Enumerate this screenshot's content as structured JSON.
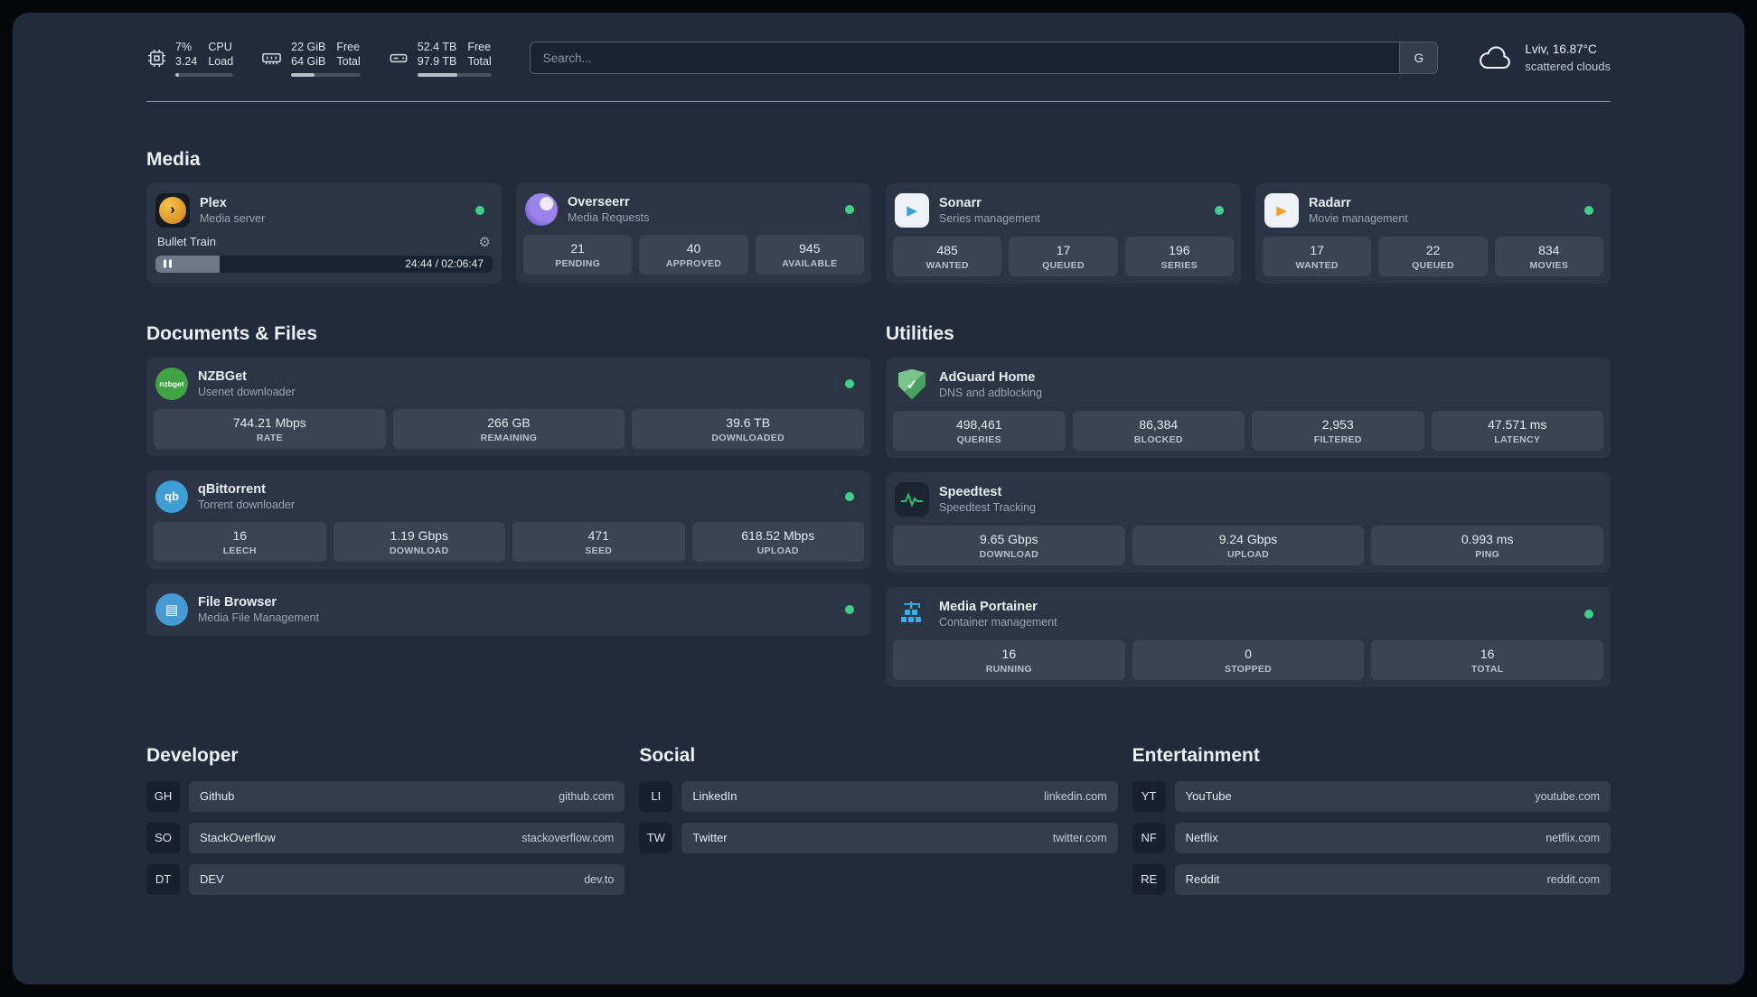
{
  "colors": {
    "background": "#212b3b",
    "card": "#2c3545",
    "stat_tile": "#3b4453",
    "status_online": "#3ecf8e",
    "plex_amber": "#e5a00d",
    "speedtest_green": "#2fbf71",
    "portainer_blue": "#2fb3e8"
  },
  "icons": {
    "plex": "›",
    "sonarr": "▶",
    "radarr": "▶",
    "nzbget": "nzbget",
    "qbittorrent": "qb",
    "filebrowser": "▤",
    "adguard_check": "✓",
    "gear": "⚙"
  },
  "topbar": {
    "resources": [
      {
        "value1": "7%",
        "value2": "3.24",
        "label1": "CPU",
        "label2": "Load",
        "progress": 7
      },
      {
        "value1": "22 GiB",
        "value2": "64 GiB",
        "label1": "Free",
        "label2": "Total",
        "progress": 34
      },
      {
        "value1": "52.4 TB",
        "value2": "97.9 TB",
        "label1": "Free",
        "label2": "Total",
        "progress": 54
      }
    ],
    "search": {
      "placeholder": "Search...",
      "button": "G"
    },
    "weather": {
      "line1": "Lviv, 16.87°C",
      "line2": "scattered clouds"
    }
  },
  "media": {
    "title": "Media",
    "plex": {
      "name": "Plex",
      "subtitle": "Media server",
      "now_playing": "Bullet Train",
      "time": "24:44 / 02:06:47",
      "progress": 19
    },
    "overseerr": {
      "name": "Overseerr",
      "subtitle": "Media Requests",
      "stats": [
        {
          "value": "21",
          "label": "PENDING"
        },
        {
          "value": "40",
          "label": "APPROVED"
        },
        {
          "value": "945",
          "label": "AVAILABLE"
        }
      ]
    },
    "sonarr": {
      "name": "Sonarr",
      "subtitle": "Series management",
      "stats": [
        {
          "value": "485",
          "label": "WANTED"
        },
        {
          "value": "17",
          "label": "QUEUED"
        },
        {
          "value": "196",
          "label": "SERIES"
        }
      ]
    },
    "radarr": {
      "name": "Radarr",
      "subtitle": "Movie management",
      "stats": [
        {
          "value": "17",
          "label": "WANTED"
        },
        {
          "value": "22",
          "label": "QUEUED"
        },
        {
          "value": "834",
          "label": "MOVIES"
        }
      ]
    }
  },
  "documents": {
    "title": "Documents & Files",
    "nzbget": {
      "name": "NZBGet",
      "subtitle": "Usenet downloader",
      "stats": [
        {
          "value": "744.21 Mbps",
          "label": "RATE"
        },
        {
          "value": "266 GB",
          "label": "REMAINING"
        },
        {
          "value": "39.6 TB",
          "label": "DOWNLOADED"
        }
      ]
    },
    "qbittorrent": {
      "name": "qBittorrent",
      "subtitle": "Torrent downloader",
      "stats": [
        {
          "value": "16",
          "label": "LEECH"
        },
        {
          "value": "1.19 Gbps",
          "label": "DOWNLOAD"
        },
        {
          "value": "471",
          "label": "SEED"
        },
        {
          "value": "618.52 Mbps",
          "label": "UPLOAD"
        }
      ]
    },
    "filebrowser": {
      "name": "File Browser",
      "subtitle": "Media File Management"
    }
  },
  "utilities": {
    "title": "Utilities",
    "adguard": {
      "name": "AdGuard Home",
      "subtitle": "DNS and adblocking",
      "stats": [
        {
          "value": "498,461",
          "label": "QUERIES"
        },
        {
          "value": "86,384",
          "label": "BLOCKED"
        },
        {
          "value": "2,953",
          "label": "FILTERED"
        },
        {
          "value": "47.571 ms",
          "label": "LATENCY"
        }
      ]
    },
    "speedtest": {
      "name": "Speedtest",
      "subtitle": "Speedtest Tracking",
      "stats": [
        {
          "value": "9.65 Gbps",
          "label": "DOWNLOAD"
        },
        {
          "value": "9.24 Gbps",
          "label": "UPLOAD"
        },
        {
          "value": "0.993 ms",
          "label": "PING"
        }
      ]
    },
    "portainer": {
      "name": "Media Portainer",
      "subtitle": "Container management",
      "stats": [
        {
          "value": "16",
          "label": "RUNNING"
        },
        {
          "value": "0",
          "label": "STOPPED"
        },
        {
          "value": "16",
          "label": "TOTAL"
        }
      ]
    }
  },
  "bookmarks": [
    {
      "title": "Developer",
      "items": [
        {
          "abbr": "GH",
          "name": "Github",
          "url": "github.com"
        },
        {
          "abbr": "SO",
          "name": "StackOverflow",
          "url": "stackoverflow.com"
        },
        {
          "abbr": "DT",
          "name": "DEV",
          "url": "dev.to"
        }
      ]
    },
    {
      "title": "Social",
      "items": [
        {
          "abbr": "LI",
          "name": "LinkedIn",
          "url": "linkedin.com"
        },
        {
          "abbr": "TW",
          "name": "Twitter",
          "url": "twitter.com"
        }
      ]
    },
    {
      "title": "Entertainment",
      "items": [
        {
          "abbr": "YT",
          "name": "YouTube",
          "url": "youtube.com"
        },
        {
          "abbr": "NF",
          "name": "Netflix",
          "url": "netflix.com"
        },
        {
          "abbr": "RE",
          "name": "Reddit",
          "url": "reddit.com"
        }
      ]
    }
  ]
}
